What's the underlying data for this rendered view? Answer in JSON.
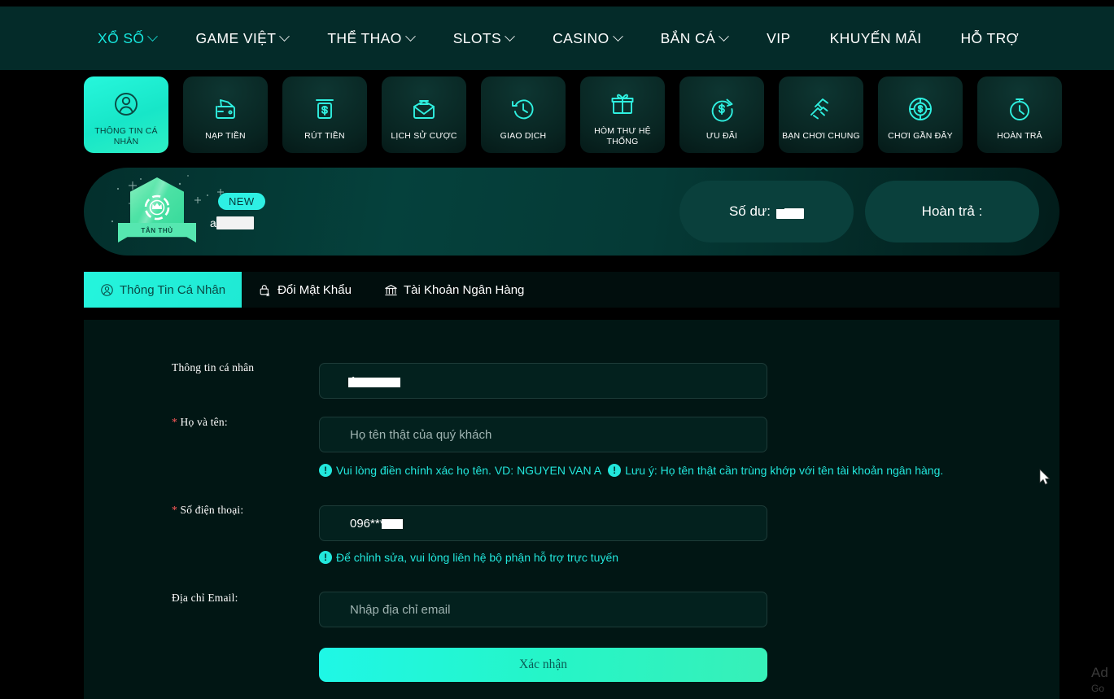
{
  "nav": {
    "items": [
      {
        "label": "XỔ SỐ",
        "caret": true,
        "active": true
      },
      {
        "label": "GAME VIỆT",
        "caret": true,
        "active": false
      },
      {
        "label": "THỂ THAO",
        "caret": true,
        "active": false
      },
      {
        "label": "SLOTS",
        "caret": true,
        "active": false
      },
      {
        "label": "CASINO",
        "caret": true,
        "active": false
      },
      {
        "label": "BẮN CÁ",
        "caret": true,
        "active": false
      },
      {
        "label": "VIP",
        "caret": false,
        "active": false
      },
      {
        "label": "KHUYẾN MÃI",
        "caret": false,
        "active": false
      },
      {
        "label": "HỖ TRỢ",
        "caret": false,
        "active": false
      }
    ]
  },
  "tiles": [
    {
      "label": "THÔNG TIN CÁ NHÂN",
      "icon": "user-circle-icon",
      "active": true
    },
    {
      "label": "NẠP TIỀN",
      "icon": "wallet-deposit-icon",
      "active": false
    },
    {
      "label": "RÚT TIỀN",
      "icon": "atm-withdraw-icon",
      "active": false
    },
    {
      "label": "LỊCH SỬ CƯỢC",
      "icon": "mail-document-icon",
      "active": false
    },
    {
      "label": "GIAO DỊCH",
      "icon": "clock-history-icon",
      "active": false
    },
    {
      "label": "HÒM THƯ HỆ THỐNG",
      "icon": "gift-icon",
      "active": false
    },
    {
      "label": "ƯU ĐÃI",
      "icon": "dollar-refresh-icon",
      "active": false
    },
    {
      "label": "BẠN CHƠI CHUNG",
      "icon": "handshake-icon",
      "active": false
    },
    {
      "label": "CHƠI GẦN ĐÂY",
      "icon": "casino-chip-icon",
      "active": false
    },
    {
      "label": "HOÀN TRẢ",
      "icon": "stopwatch-icon",
      "active": false
    }
  ],
  "banner": {
    "badge_ribbon": "TÂN THỦ",
    "new_tag": "NEW",
    "username": "a",
    "balance_label": "Số dư:",
    "rebate_label": "Hoàn trả :"
  },
  "tabs": [
    {
      "label": "Thông Tin Cá Nhân",
      "icon": "user-circle-icon",
      "active": true
    },
    {
      "label": "Đổi Mật Khẩu",
      "icon": "lock-x-icon",
      "active": false
    },
    {
      "label": "Tài Khoản Ngân Hàng",
      "icon": "bank-icon",
      "active": false
    }
  ],
  "form": {
    "account_label": "Thông tin cá nhân",
    "account_value": "1",
    "fullname_label": "Họ và tên:",
    "fullname_placeholder": "Họ tên thật của quý khách",
    "fullname_hint_1": "Vui lòng điền chính xác họ tên. VD: NGUYEN VAN A",
    "fullname_hint_2": "Lưu ý: Họ tên thật cần trùng khớp với tên tài khoản ngân hàng.",
    "phone_label": "Số điện thoại:",
    "phone_value": "096*****3",
    "phone_hint": "Để chỉnh sửa, vui lòng liên hệ bộ phận hỗ trợ trực tuyến",
    "email_label": "Địa chỉ Email:",
    "email_placeholder": "Nhập địa chỉ email",
    "submit_label": "Xác nhận",
    "required_mark": "*",
    "bang": "!"
  },
  "ad": {
    "line1": "Ad",
    "line2": "Go"
  },
  "colors": {
    "accent": "#22e7dc",
    "nav_bg": "#042b29",
    "panel_bg": "#011614",
    "page_bg": "#000000",
    "badge_green": "#4fe3a6",
    "required_red": "#ff5a5a"
  }
}
